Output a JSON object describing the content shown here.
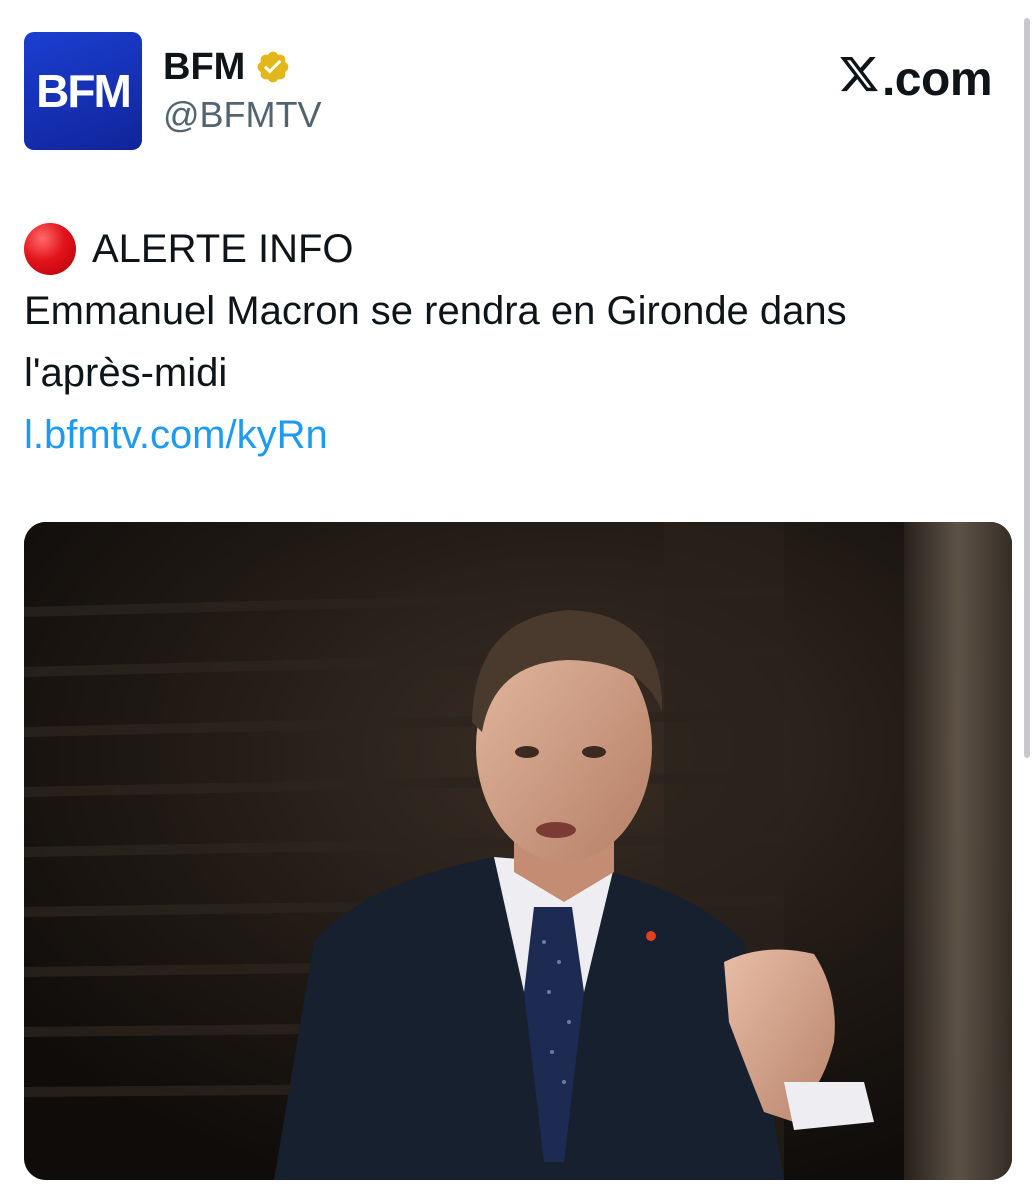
{
  "header": {
    "avatar_text": "BFM",
    "display_name": "BFM",
    "handle": "@BFMTV",
    "site_logo_text": ".com",
    "verified_color": "#E2B719"
  },
  "tweet": {
    "alert_label": "ALERTE INFO",
    "alert_icon": "red-circle-icon",
    "body_line1": "Emmanuel Macron se rendra en Gironde dans",
    "body_line2": "l'après-midi",
    "link": "l.bfmtv.com/kyRn"
  },
  "media": {
    "subject": "photo-of-speaker"
  },
  "colors": {
    "link": "#1d9bf0",
    "brand": "#1b3fd1",
    "alert": "#e2131b"
  }
}
